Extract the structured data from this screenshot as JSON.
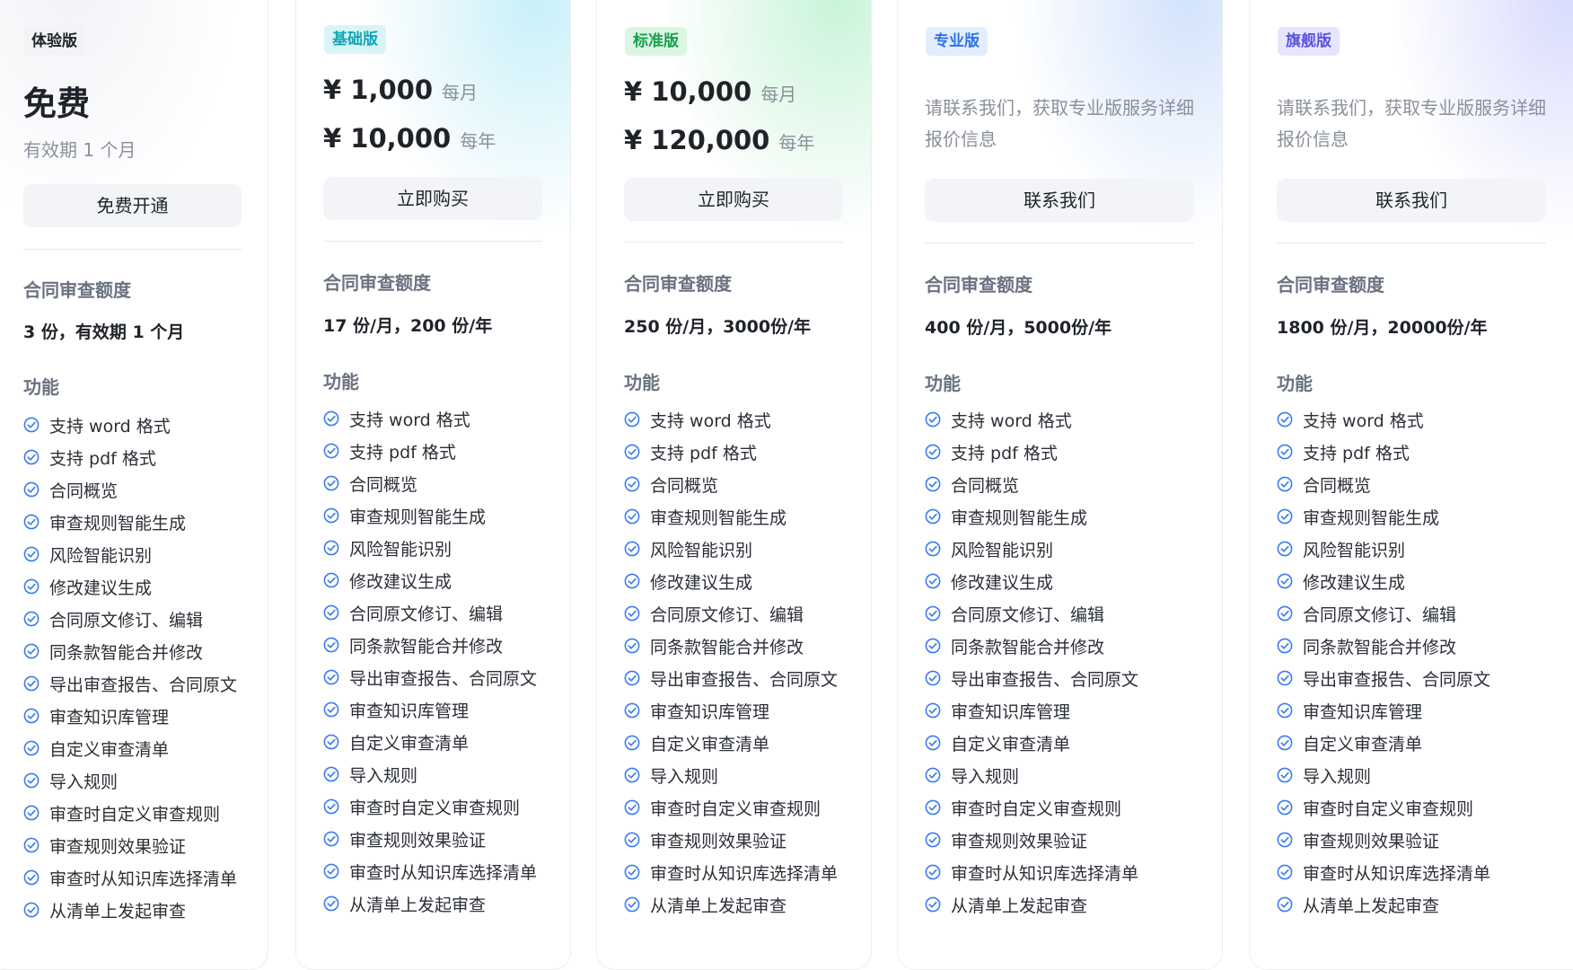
{
  "colors": {
    "check": "#3b7cf0"
  },
  "plans": [
    {
      "tag": "体验版",
      "title": "免费",
      "validity": "有效期 1 个月",
      "button": "免费开通",
      "quota_title": "合同审查额度",
      "quota": "3 份，有效期 1 个月",
      "features_title": "功能",
      "features": [
        "支持 word 格式",
        "支持 pdf 格式",
        "合同概览",
        "审查规则智能生成",
        "风险智能识别",
        "修改建议生成",
        "合同原文修订、编辑",
        "同条款智能合并修改",
        "导出审查报告、合同原文",
        "审查知识库管理",
        "自定义审查清单",
        "导入规则",
        "审查时自定义审查规则",
        "审查规则效果验证",
        "审查时从知识库选择清单",
        "从清单上发起审查"
      ]
    },
    {
      "tag": "基础版",
      "price_month": "¥ 1,000",
      "month_unit": "每月",
      "price_year": "¥ 10,000",
      "year_unit": "每年",
      "button": "立即购买",
      "quota_title": "合同审查额度",
      "quota": "17 份/月，200 份/年",
      "features_title": "功能",
      "features": [
        "支持 word 格式",
        "支持 pdf 格式",
        "合同概览",
        "审查规则智能生成",
        "风险智能识别",
        "修改建议生成",
        "合同原文修订、编辑",
        "同条款智能合并修改",
        "导出审查报告、合同原文",
        "审查知识库管理",
        "自定义审查清单",
        "导入规则",
        "审查时自定义审查规则",
        "审查规则效果验证",
        "审查时从知识库选择清单",
        "从清单上发起审查"
      ]
    },
    {
      "tag": "标准版",
      "price_month": "¥ 10,000",
      "month_unit": "每月",
      "price_year": "¥ 120,000",
      "year_unit": "每年",
      "button": "立即购买",
      "quota_title": "合同审查额度",
      "quota": "250 份/月，3000份/年",
      "features_title": "功能",
      "features": [
        "支持 word 格式",
        "支持 pdf 格式",
        "合同概览",
        "审查规则智能生成",
        "风险智能识别",
        "修改建议生成",
        "合同原文修订、编辑",
        "同条款智能合并修改",
        "导出审查报告、合同原文",
        "审查知识库管理",
        "自定义审查清单",
        "导入规则",
        "审查时自定义审查规则",
        "审查规则效果验证",
        "审查时从知识库选择清单",
        "从清单上发起审查"
      ]
    },
    {
      "tag": "专业版",
      "contact_text": "请联系我们，获取专业版服务详细报价信息",
      "button": "联系我们",
      "quota_title": "合同审查额度",
      "quota": "400 份/月，5000份/年",
      "features_title": "功能",
      "features": [
        "支持 word 格式",
        "支持 pdf 格式",
        "合同概览",
        "审查规则智能生成",
        "风险智能识别",
        "修改建议生成",
        "合同原文修订、编辑",
        "同条款智能合并修改",
        "导出审查报告、合同原文",
        "审查知识库管理",
        "自定义审查清单",
        "导入规则",
        "审查时自定义审查规则",
        "审查规则效果验证",
        "审查时从知识库选择清单",
        "从清单上发起审查"
      ]
    },
    {
      "tag": "旗舰版",
      "contact_text": "请联系我们，获取专业版服务详细报价信息",
      "button": "联系我们",
      "quota_title": "合同审查额度",
      "quota": "1800 份/月，20000份/年",
      "features_title": "功能",
      "features": [
        "支持 word 格式",
        "支持 pdf 格式",
        "合同概览",
        "审查规则智能生成",
        "风险智能识别",
        "修改建议生成",
        "合同原文修订、编辑",
        "同条款智能合并修改",
        "导出审查报告、合同原文",
        "审查知识库管理",
        "自定义审查清单",
        "导入规则",
        "审查时自定义审查规则",
        "审查规则效果验证",
        "审查时从知识库选择清单",
        "从清单上发起审查"
      ]
    }
  ]
}
